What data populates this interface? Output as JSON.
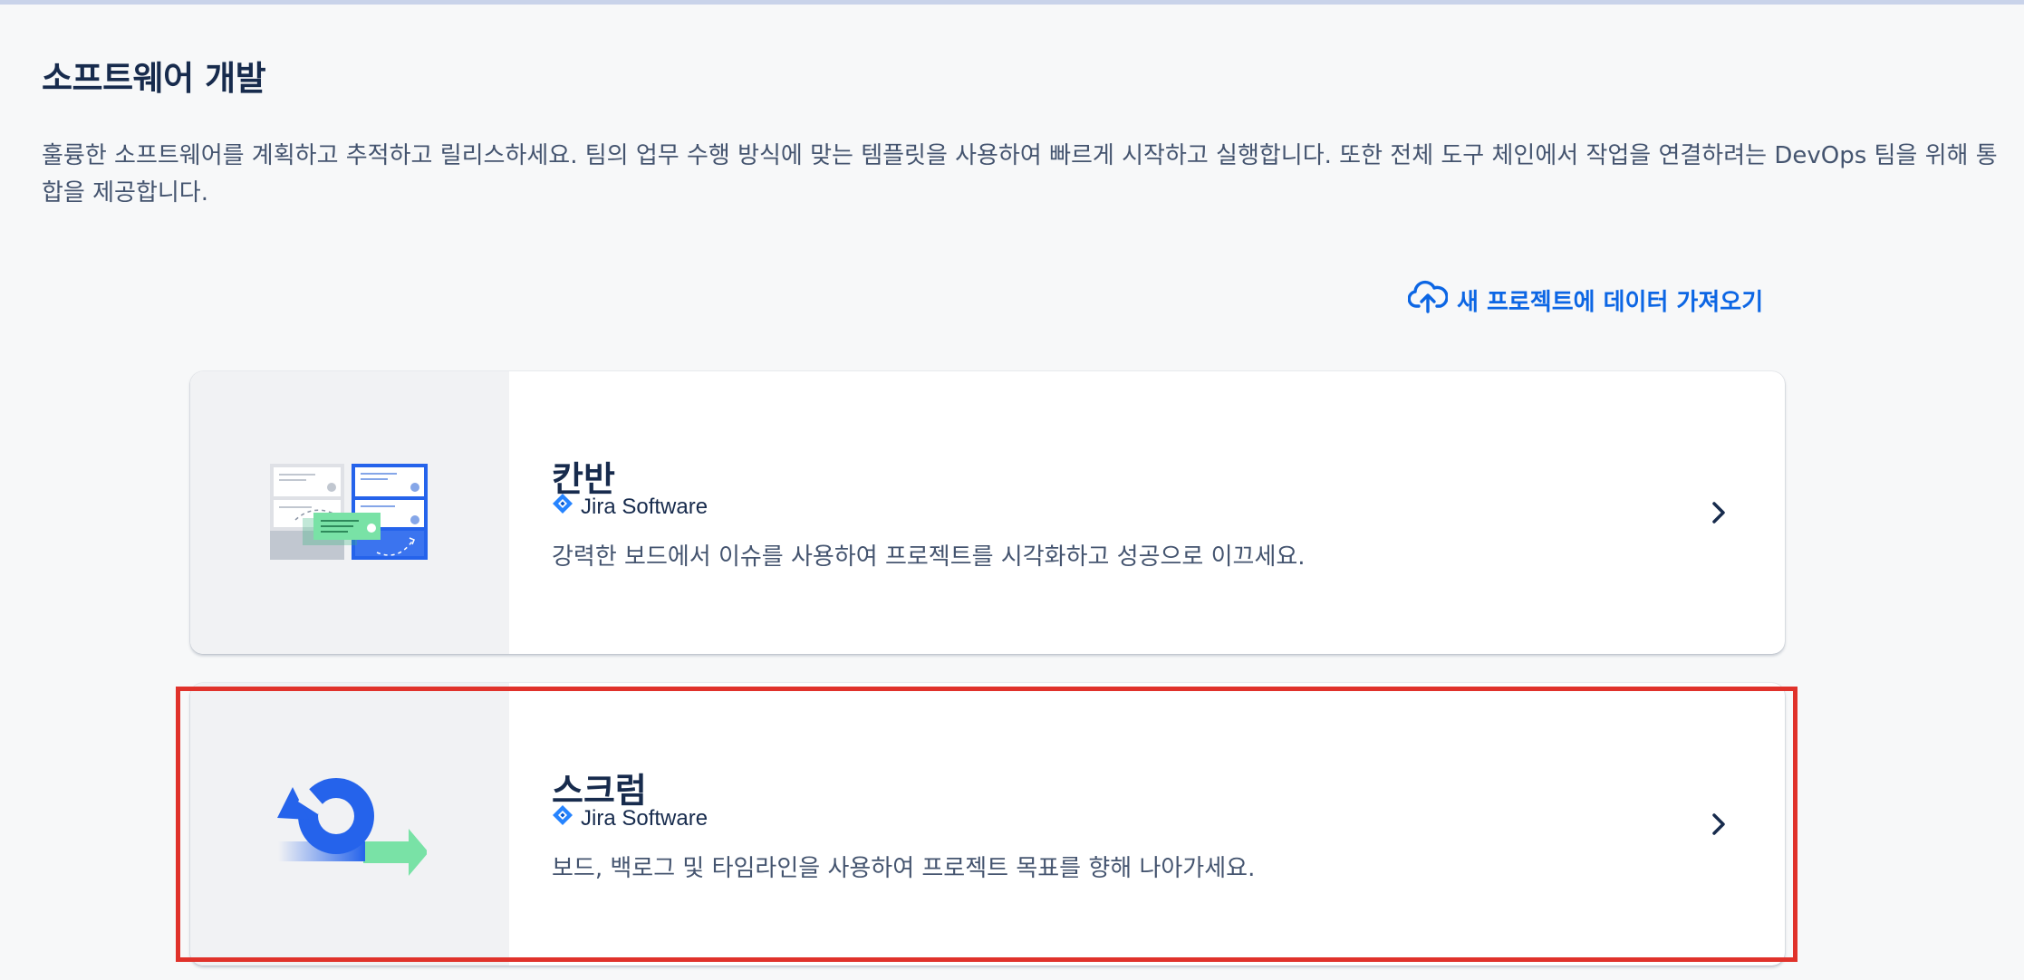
{
  "page": {
    "title": "소프트웨어 개발",
    "description": "훌륭한 소프트웨어를 계획하고 추적하고 릴리스하세요. 팀의 업무 수행 방식에 맞는 템플릿을 사용하여 빠르게 시작하고 실행합니다. 또한 전체 도구 체인에서 작업을 연결하려는 DevOps 팀을 위해 통합을 제공합니다."
  },
  "import": {
    "label": "새 프로젝트에 데이터 가져오기",
    "icon": "cloud-upload-icon"
  },
  "templates": [
    {
      "title": "칸반",
      "product": "Jira Software",
      "description": "강력한 보드에서 이슈를 사용하여 프로젝트를 시각화하고 성공으로 이끄세요.",
      "icon": "kanban-board-illustration"
    },
    {
      "title": "스크럼",
      "product": "Jira Software",
      "description": "보드, 백로그 및 타임라인을 사용하여 프로젝트 목표를 향해 나아가세요.",
      "icon": "scrum-cycle-illustration"
    }
  ],
  "colors": {
    "accent": "#0c66e4",
    "highlight": "#e0322b",
    "background": "#f7f8f9"
  }
}
